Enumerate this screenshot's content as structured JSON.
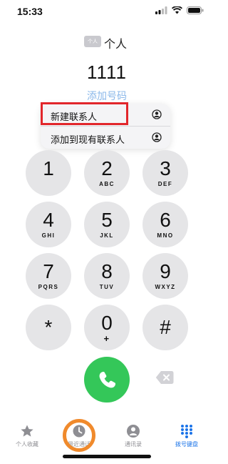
{
  "status_bar": {
    "time": "15:33"
  },
  "sim": {
    "badge": "个人",
    "name": "个人"
  },
  "dial": {
    "number": "1111",
    "add_number": "添加号码"
  },
  "menu": {
    "items": [
      {
        "label": "新建联系人",
        "icon": "person-circle-icon"
      },
      {
        "label": "添加到现有联系人",
        "icon": "person-circle-icon"
      }
    ]
  },
  "keypad": [
    {
      "digit": "1",
      "letters": ""
    },
    {
      "digit": "2",
      "letters": "ABC"
    },
    {
      "digit": "3",
      "letters": "DEF"
    },
    {
      "digit": "4",
      "letters": "GHI"
    },
    {
      "digit": "5",
      "letters": "JKL"
    },
    {
      "digit": "6",
      "letters": "MNO"
    },
    {
      "digit": "7",
      "letters": "PQRS"
    },
    {
      "digit": "8",
      "letters": "TUV"
    },
    {
      "digit": "9",
      "letters": "WXYZ"
    },
    {
      "digit": "*",
      "letters": ""
    },
    {
      "digit": "0",
      "letters": "+"
    },
    {
      "digit": "#",
      "letters": ""
    }
  ],
  "tabs": [
    {
      "label": "个人收藏",
      "icon": "star-icon"
    },
    {
      "label": "最近通话",
      "icon": "clock-icon"
    },
    {
      "label": "通讯录",
      "icon": "contacts-icon"
    },
    {
      "label": "拨号键盘",
      "icon": "keypad-icon"
    }
  ],
  "colors": {
    "accent": "#1a73e8",
    "call": "#34c759",
    "highlight": "#e2262b",
    "ring": "#f08a2c"
  }
}
